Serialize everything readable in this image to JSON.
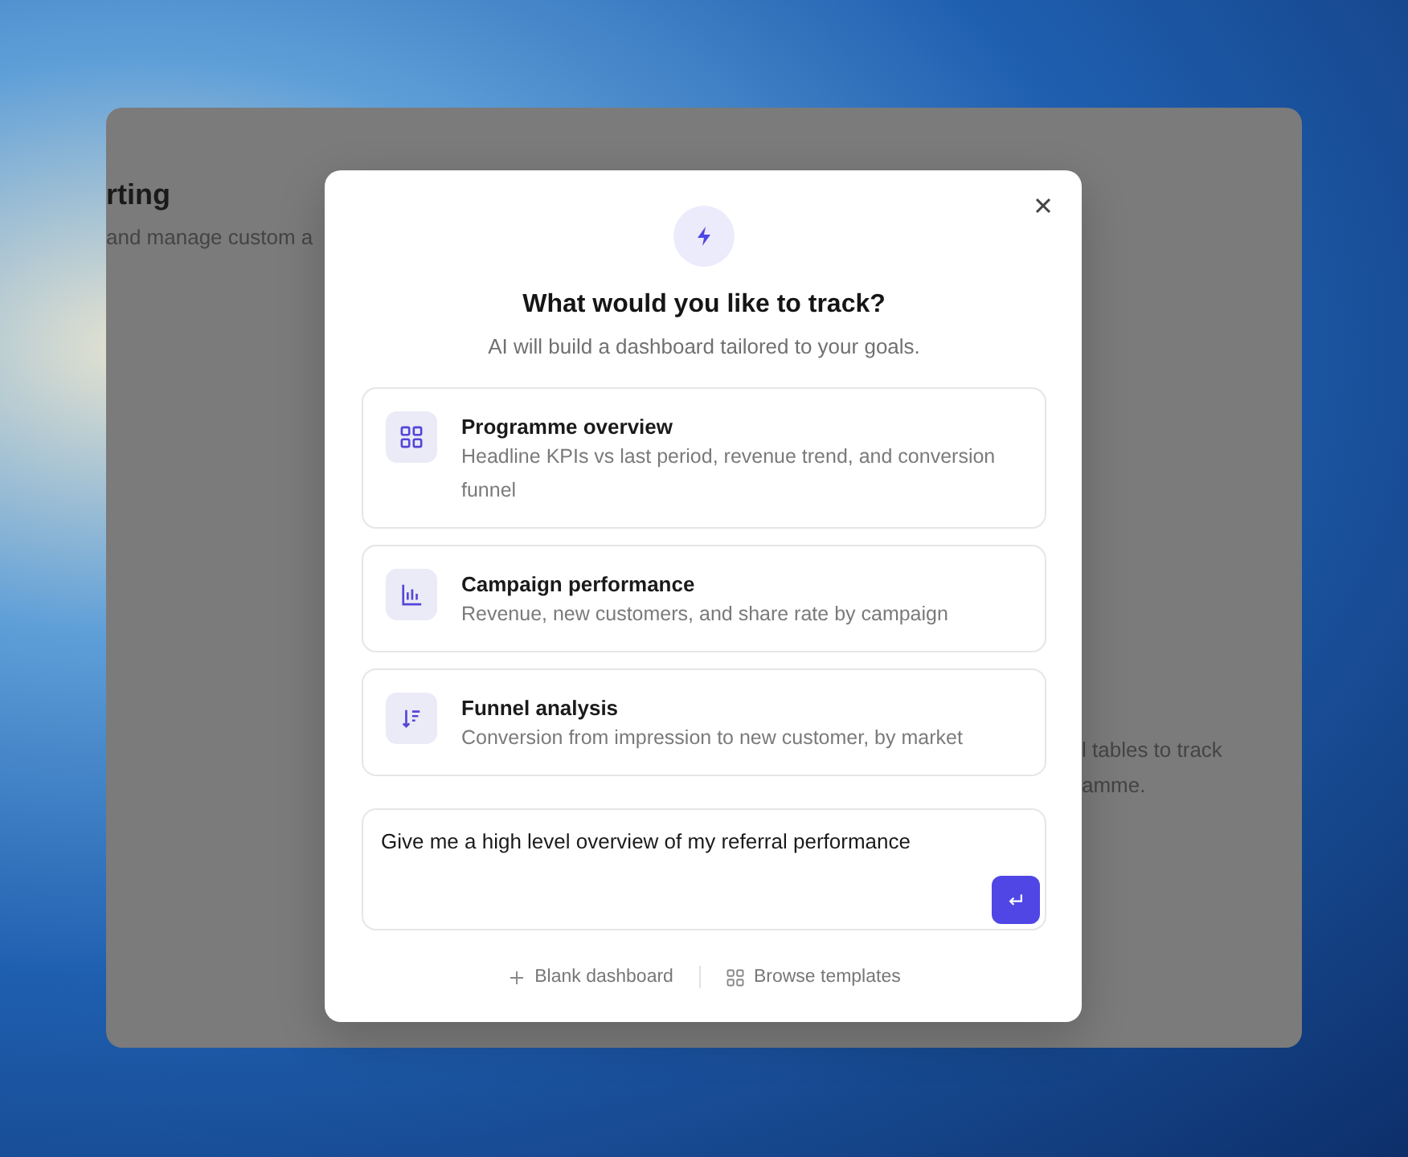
{
  "background_page": {
    "heading": "rting",
    "subheading": "and manage custom a",
    "body_lines": [
      "l tables to track",
      "amme."
    ]
  },
  "dialog": {
    "title": "What would you like to track?",
    "subtitle": "AI will build a dashboard tailored to your goals.",
    "options": [
      {
        "kind": "grid",
        "title": "Programme overview",
        "description": "Headline KPIs vs last period, revenue trend, and conversion funnel"
      },
      {
        "kind": "bars",
        "title": "Campaign performance",
        "description": "Revenue, new customers, and share rate by campaign"
      },
      {
        "kind": "funnel",
        "title": "Funnel analysis",
        "description": "Conversion from impression to new customer, by market"
      }
    ],
    "prompt": {
      "value": "Give me a high level overview of my referral performance"
    },
    "footer": [
      {
        "kind": "plus",
        "label": "Blank dashboard"
      },
      {
        "kind": "grid",
        "label": "Browse templates"
      }
    ]
  }
}
